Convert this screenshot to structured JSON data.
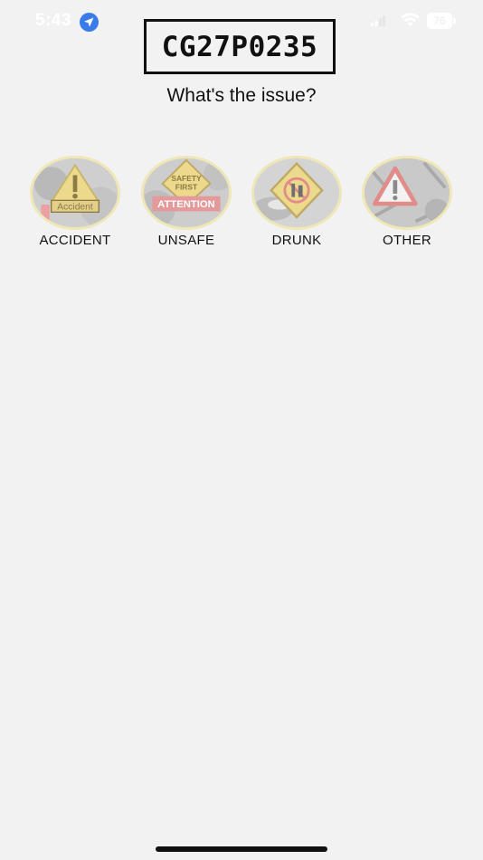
{
  "status_bar": {
    "time": "5:43",
    "battery": "76",
    "icons": [
      "location-arrow-icon",
      "cellular-signal-icon",
      "wifi-icon",
      "battery-icon"
    ]
  },
  "plate": {
    "number": "CG27P0235"
  },
  "question": "What's the issue?",
  "options": [
    {
      "label": "ACCIDENT",
      "icon": "accident-warning-icon"
    },
    {
      "label": "UNSAFE",
      "icon": "safety-first-attention-icon"
    },
    {
      "label": "DRUNK",
      "icon": "no-drinking-sign-icon"
    },
    {
      "label": "OTHER",
      "icon": "warning-triangle-icon"
    }
  ],
  "image_text": {
    "accident_sign": "Accident",
    "unsafe_sign_top": "SAFETY",
    "unsafe_sign_bottom": "FIRST",
    "unsafe_banner": "ATTENTION"
  },
  "colors": {
    "background": "#f2f2f2",
    "circle_border": "#efe7b5",
    "location_blue": "#3a7bea"
  }
}
